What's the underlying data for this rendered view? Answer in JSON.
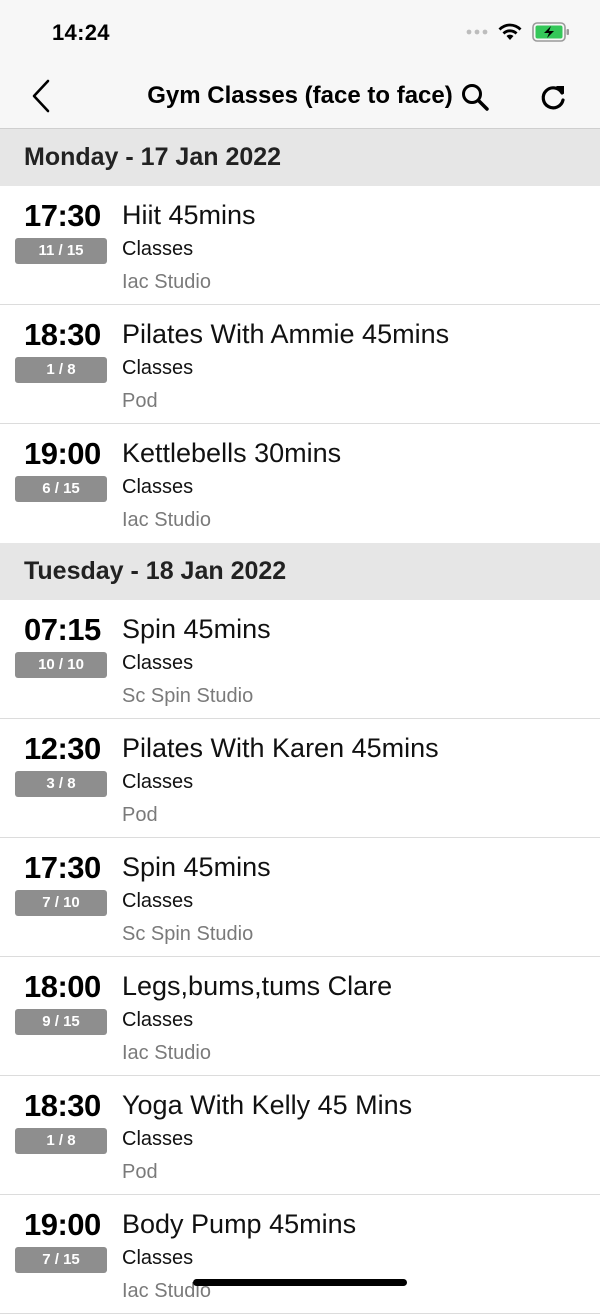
{
  "status_bar": {
    "time": "14:24"
  },
  "header": {
    "title": "Gym Classes (face to face)"
  },
  "days": [
    {
      "label": "Monday - 17 Jan 2022",
      "classes": [
        {
          "time": "17:30",
          "spaces": "11 / 15",
          "name": "Hiit 45mins",
          "type": "Classes",
          "location": "Iac Studio"
        },
        {
          "time": "18:30",
          "spaces": "1 / 8",
          "name": "Pilates With Ammie 45mins",
          "type": "Classes",
          "location": "Pod"
        },
        {
          "time": "19:00",
          "spaces": "6 / 15",
          "name": "Kettlebells 30mins",
          "type": "Classes",
          "location": "Iac Studio"
        }
      ]
    },
    {
      "label": "Tuesday - 18 Jan 2022",
      "classes": [
        {
          "time": "07:15",
          "spaces": "10 / 10",
          "name": "Spin 45mins",
          "type": "Classes",
          "location": "Sc Spin Studio"
        },
        {
          "time": "12:30",
          "spaces": "3 / 8",
          "name": "Pilates With Karen 45mins",
          "type": "Classes",
          "location": "Pod"
        },
        {
          "time": "17:30",
          "spaces": "7 / 10",
          "name": "Spin 45mins",
          "type": "Classes",
          "location": "Sc Spin Studio"
        },
        {
          "time": "18:00",
          "spaces": "9 / 15",
          "name": "Legs,bums,tums Clare",
          "type": "Classes",
          "location": "Iac Studio"
        },
        {
          "time": "18:30",
          "spaces": "1 / 8",
          "name": "Yoga With Kelly 45 Mins",
          "type": "Classes",
          "location": "Pod"
        },
        {
          "time": "19:00",
          "spaces": "7 / 15",
          "name": "Body Pump 45mins",
          "type": "Classes",
          "location": "Iac Studio"
        }
      ]
    }
  ],
  "icons": {
    "back": "chevron-left-icon",
    "search": "search-icon",
    "refresh": "refresh-icon",
    "wifi": "wifi-icon",
    "battery": "battery-charging-icon"
  },
  "colors": {
    "badge": "#8e8e8e",
    "day_header_bg": "#e6e6e6",
    "nav_bg": "#f7f7f7",
    "battery_fill": "#34c759"
  }
}
